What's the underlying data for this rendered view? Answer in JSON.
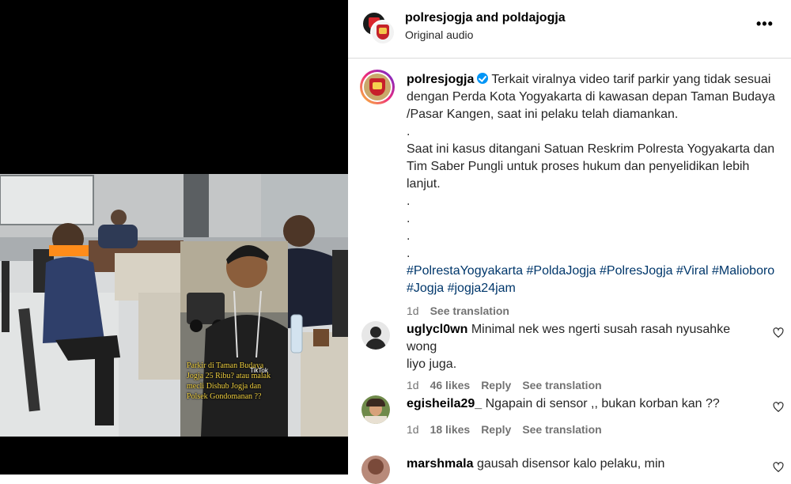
{
  "header": {
    "names": "polresjogja and poldajogja",
    "audio": "Original audio",
    "more": "•••"
  },
  "video_overlay": {
    "text": "Parkir di Taman Budaya Jogja 25 Ribu? atau malak mecli Dishub Jogja dan Polsek Gondomanan ??",
    "watermark": "TikTok"
  },
  "caption": {
    "username": "polresjogja",
    "lines": [
      "Terkait viralnya video tarif parkir yang tidak sesuai",
      "dengan Perda Kota Yogyakarta di kawasan depan Taman Budaya",
      "/Pasar Kangen, saat ini pelaku telah diamankan.",
      ".",
      "Saat ini kasus ditangani Satuan Reskrim Polresta Yogyakarta dan",
      "Tim Saber Pungli untuk proses hukum dan penyelidikan lebih",
      "lanjut.",
      ".",
      ".",
      ".",
      "."
    ],
    "hashtags1": "#PolrestaYogyakarta #PoldaJogja #PolresJogja #Viral #Malioboro",
    "hashtags2": "#Jogja #jogja24jam",
    "time": "1d",
    "see_translation": "See translation"
  },
  "comments": [
    {
      "username": "uglycl0wn",
      "text": "Minimal nek wes ngerti susah rasah nyusahke wong",
      "text2": "liyo juga.",
      "time": "1d",
      "likes": "46 likes",
      "reply": "Reply",
      "see_translation": "See translation"
    },
    {
      "username": "egisheila29_",
      "text": "Ngapain di sensor ,, bukan korban kan ??",
      "time": "1d",
      "likes": "18 likes",
      "reply": "Reply",
      "see_translation": "See translation"
    },
    {
      "username": "marshmala",
      "text": "gausah disensor kalo pelaku, min"
    }
  ]
}
